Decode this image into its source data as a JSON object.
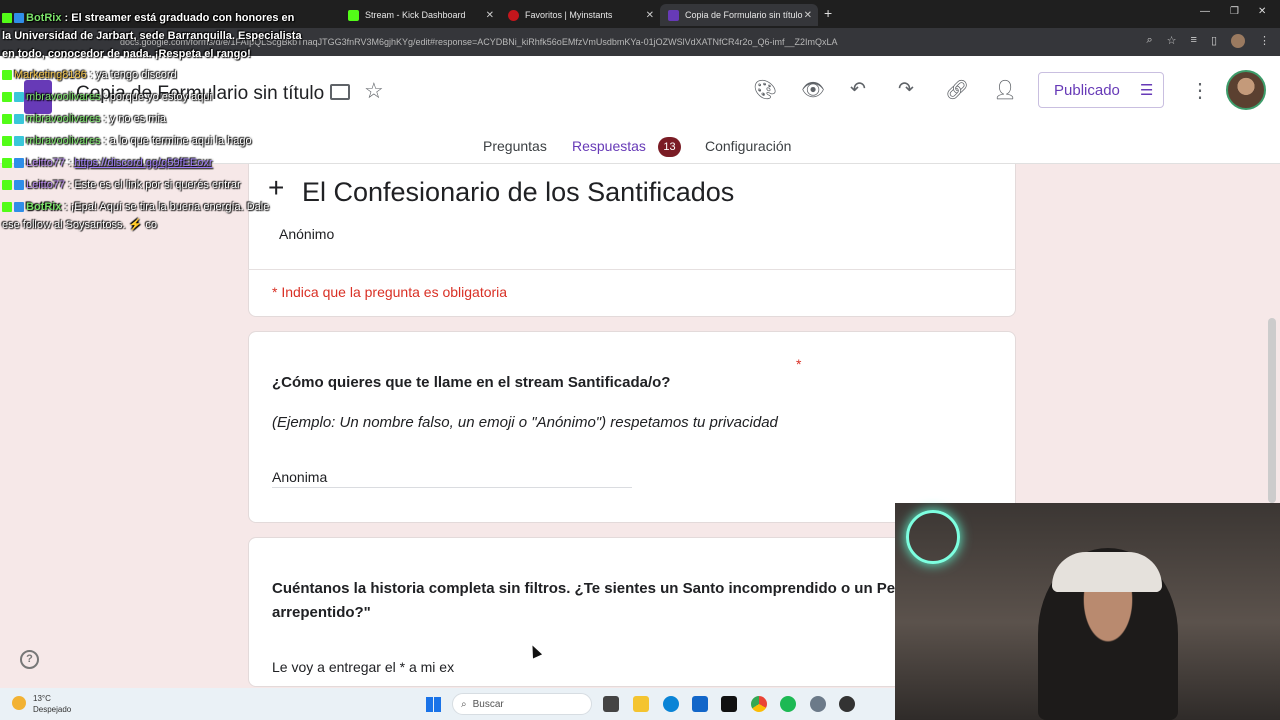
{
  "browser": {
    "tabs": [
      {
        "label": "Stream - Kick Dashboard",
        "color": "#53fc18"
      },
      {
        "label": "Favoritos | Myinstants",
        "color": "#c4161c"
      },
      {
        "label": "Copia de Formulario sin título",
        "color": "#673ab7"
      }
    ],
    "url": "docs.google.com/forms/d/e/1FAIpQLScgBkbTnaqJTGG3fnRV3M6gjhKYg/edit#response=ACYDBNi_kiRhfk56oEMfzVmUsdbmKYa-01jOZWSlVdXATNfCR4r2o_Q6-imf__Z2ImQxLA"
  },
  "form": {
    "title": "Copia de Formulario sin título",
    "publish_label": "Publicado",
    "tabs": {
      "questions": "Preguntas",
      "responses": "Respuestas",
      "responses_count": "13",
      "settings": "Configuración"
    },
    "section_title": "El Confesionario de los Santificados",
    "anonymous": "Anónimo",
    "required_note": "* Indica que la pregunta es obligatoria",
    "q1": {
      "title": "¿Cómo quieres que te llame en el stream Santificada/o?",
      "description": "(Ejemplo: Un nombre falso, un emoji o \"Anónimo\") respetamos tu privacidad",
      "answer": "Anonima"
    },
    "q2": {
      "title_line1": "Cuéntanos la historia completa sin filtros. ¿Te sientes un Santo incomprendido o un Pe",
      "title_line2": "arrepentido?\"",
      "answer": "Le voy a entregar el * a mi ex"
    }
  },
  "chat": [
    {
      "user": "BotRix",
      "text": " : El streamer está graduado con honores en"
    },
    {
      "user": "",
      "text": "la Universidad de Jarbart, sede Barranquilla. Especialista"
    },
    {
      "user": "",
      "text": "en todo, conocedor de nada. ¡Respeta el rango!"
    },
    {
      "user": "Marketing8186",
      "text": " : ya tengo discord"
    },
    {
      "user": "mbravoolivares",
      "text": " : porque yo estoy aqui"
    },
    {
      "user": "mbravoolivares",
      "text": " : y no es mia"
    },
    {
      "user": "mbravoolivares",
      "text": " : a lo que termine aqui la hago"
    },
    {
      "user": "Leitto77",
      "text": " : ",
      "link": "https://discord.gg/q59fEEoxr"
    },
    {
      "user": "Leitto77",
      "text": " : Este es el link por si querés entrar"
    },
    {
      "user": "BotRix",
      "text": " : ¡Epa! Aquí se tira la buena energía. Dale"
    },
    {
      "user": "",
      "text": "ese follow al Soysantoss. ⚡ co"
    }
  ],
  "taskbar": {
    "temp": "13°C",
    "weather": "Despejado",
    "search_placeholder": "Buscar"
  }
}
